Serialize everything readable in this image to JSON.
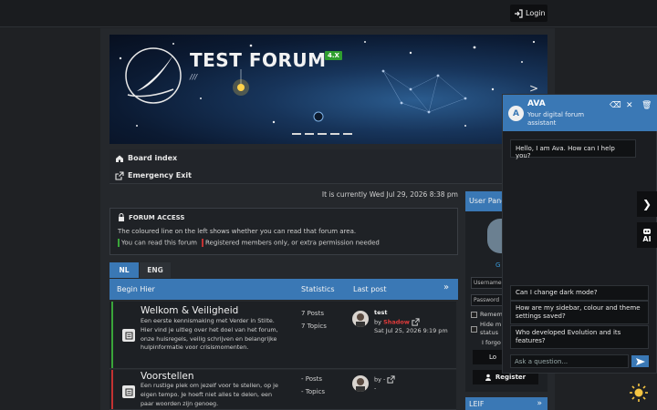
{
  "header": {
    "login_label": "Login"
  },
  "banner": {
    "title": "TEST FORUM",
    "version": "4.X",
    "subtitle": "///",
    "next": ">"
  },
  "nav": {
    "board_index": "Board index",
    "emergency_exit": "Emergency Exit"
  },
  "current_time": "It is currently Wed Jul 29, 2026 8:38 pm",
  "forum_access": {
    "title": "FORUM ACCESS",
    "text": "The coloured line on the left shows whether you can read that forum area.",
    "legend_green": "You can read this forum",
    "legend_red": "Registered members only, or extra permission needed"
  },
  "tabs": [
    "NL",
    "ENG"
  ],
  "forum_table": {
    "category": "Begin Hier",
    "statistics_label": "Statistics",
    "last_post_label": "Last post",
    "rows": [
      {
        "name": "Welkom & Veiligheid",
        "description": "Een eerste kennismaking met Verder in Stilte. Hier vind je uitleg over het doel van het forum, onze huisregels, veilig schrijven en belangrijke hulpinformatie voor crisismomenten.",
        "posts": "7 Posts",
        "topics": "7 Topics",
        "last_title": "test",
        "last_by": "by",
        "last_user": "Shadow",
        "last_date": "Sat Jul 25, 2026 9:19 pm",
        "accent": "#3aa53a"
      },
      {
        "name": "Voorstellen",
        "description": "Een rustige plek om jezelf voor te stellen, op je eigen tempo. Je hoeft niet alles te delen, een paar woorden zijn genoeg.",
        "posts": "- Posts",
        "topics": "- Topics",
        "last_title": "",
        "last_by": "by -",
        "last_user": "",
        "last_date": "-",
        "accent": "#c23232"
      }
    ]
  },
  "user_panel": {
    "title": "User Panel",
    "guest": "G",
    "username_placeholder": "Username",
    "password_placeholder": "Password",
    "remember": "Rememb",
    "hide": "Hide m status",
    "forgot": "I forgo",
    "login": "Lo",
    "register": "Register"
  },
  "leif": {
    "title": "LEIF"
  },
  "chat": {
    "name": "AVA",
    "subtitle": "Your digital forum assistant",
    "logo": "A",
    "greeting": "Hello, I am Ava. How can I help you?",
    "suggestions": [
      "Can I change dark mode?",
      "How are my sidebar, colour and theme settings saved?",
      "Who developed Evolution and its features?"
    ],
    "input_placeholder": "Ask a question...",
    "side_next": "❯",
    "side_ai": "AI"
  },
  "colors": {
    "accent": "#3a78b5",
    "green": "#3aa53a",
    "red": "#c23232",
    "user": "#e23b3b"
  }
}
